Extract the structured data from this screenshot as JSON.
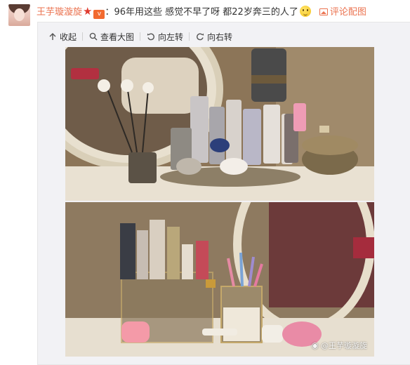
{
  "post": {
    "author": "王芋璇漩旋",
    "colon": "：",
    "text": "96年用这些 感觉不早了呀 都22岁奔三的人了",
    "comment_pic_label": "评论配图"
  },
  "toolbar": {
    "collapse_label": "收起",
    "view_large_label": "查看大图",
    "rotate_left_label": "向左转",
    "rotate_right_label": "向右转"
  },
  "photos": {
    "watermark": "@王芋璇漩旋"
  },
  "colors": {
    "author_link": "#eb7350",
    "card_bg": "#f2f2f5",
    "accent_red": "#e03a2f"
  },
  "icons": {
    "collapse": "arrow-up-icon",
    "view_large": "magnifier-icon",
    "rotate_left": "rotate-left-icon",
    "rotate_right": "rotate-right-icon",
    "comment_pic": "picture-icon",
    "star": "star-icon",
    "emoji": "smile-emoji-icon",
    "weibo": "weibo-logo-icon"
  }
}
